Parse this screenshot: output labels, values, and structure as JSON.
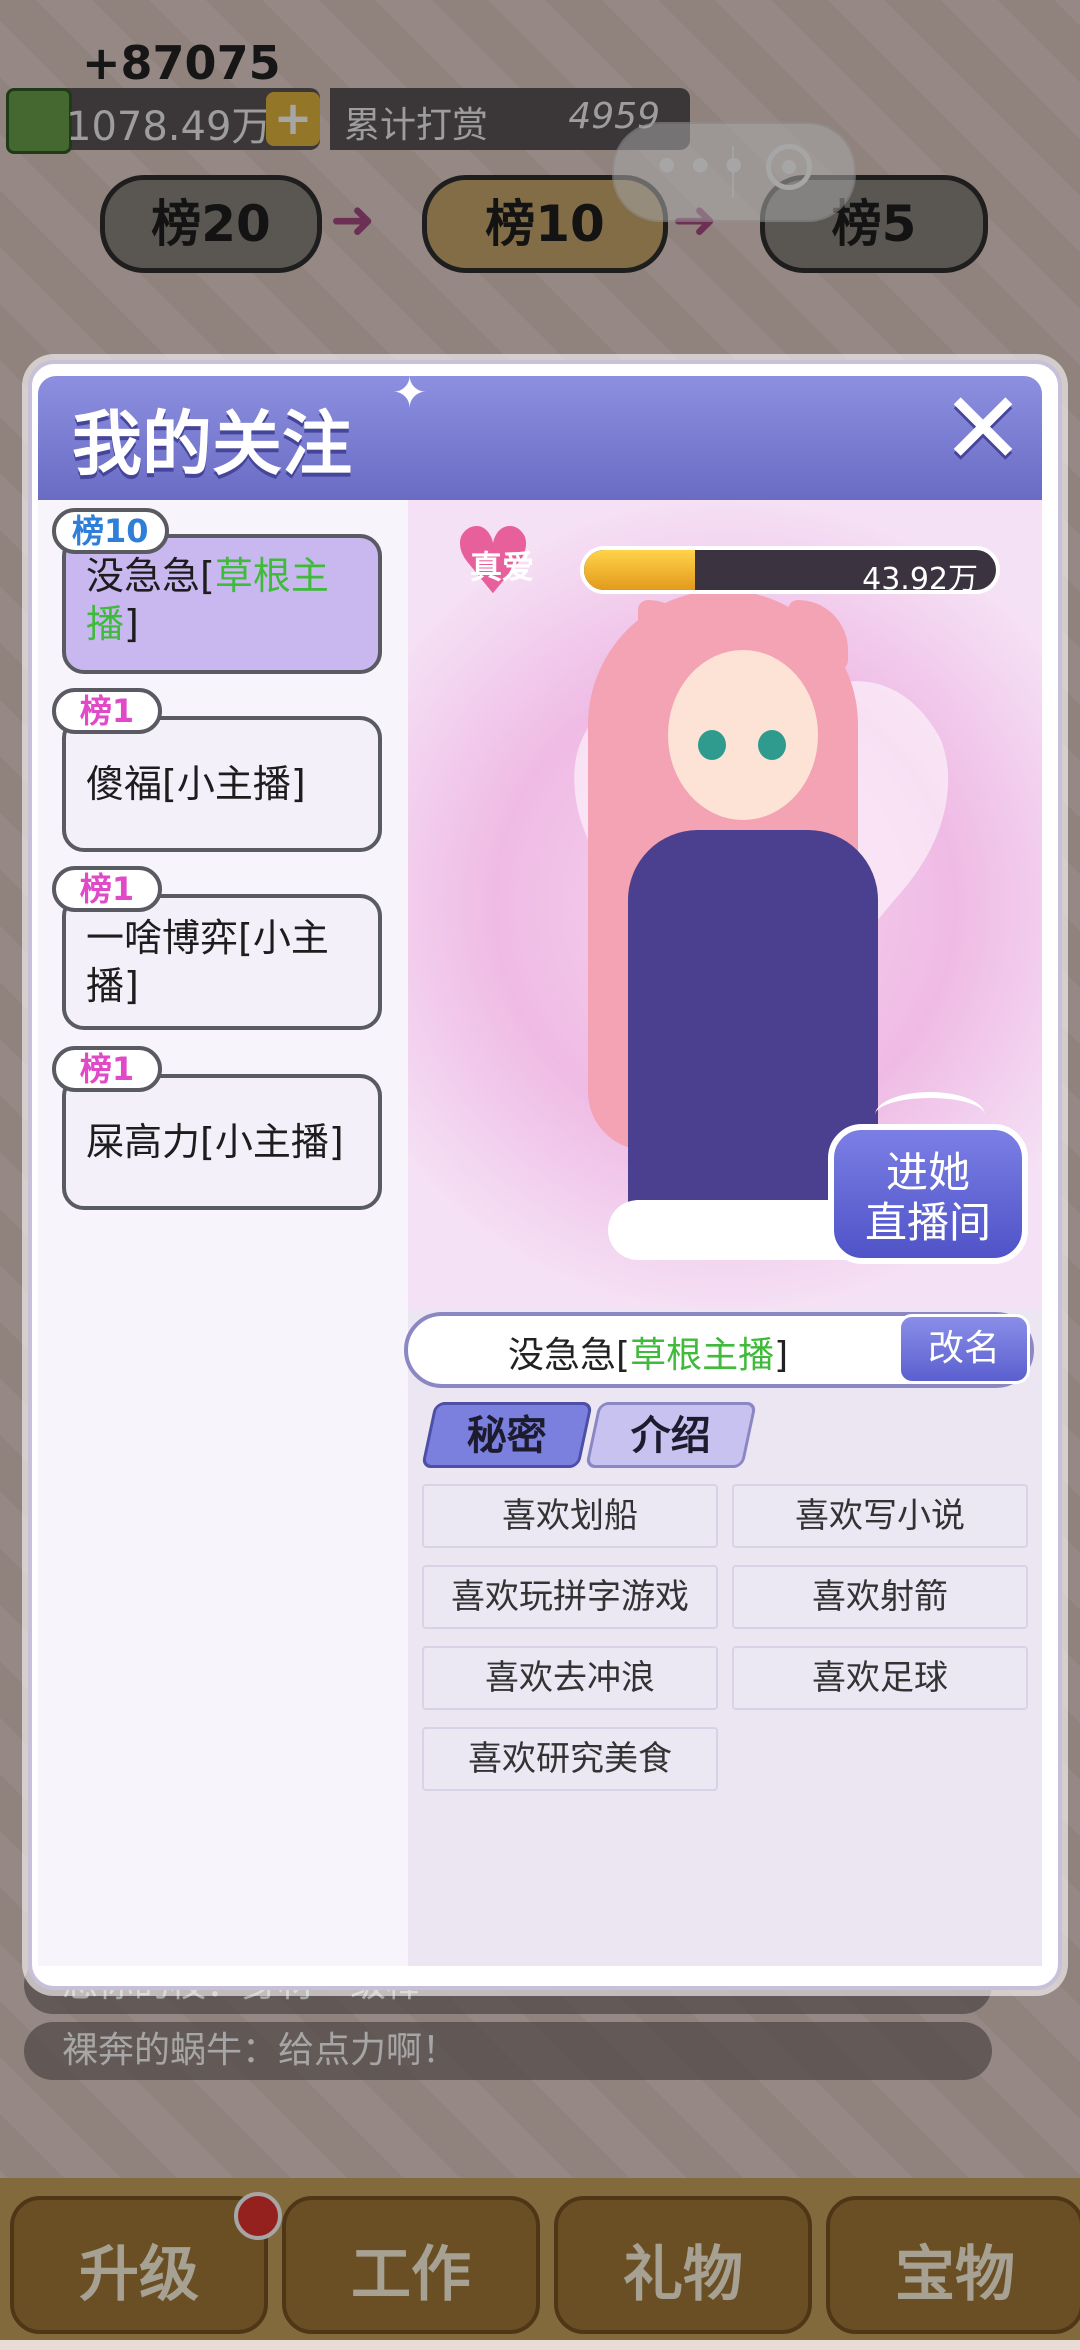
{
  "hud": {
    "amount_gain": "+87075",
    "money": "1078.49万",
    "plus": "+",
    "reward_label": "累计打赏",
    "reward_value": "4959"
  },
  "ranks": [
    {
      "label": "榜20"
    },
    {
      "label": "榜10"
    },
    {
      "label": "榜5"
    }
  ],
  "wechat_capsule": {
    "more_icon": "more-dots-icon",
    "close_icon": "target-circle-icon"
  },
  "modal": {
    "title": "我的关注",
    "close_label": "✕",
    "follows": [
      {
        "tag": "榜10",
        "tag_color": "#2f7fd8",
        "name": "没急急",
        "level": "草根主播",
        "selected": true
      },
      {
        "tag": "榜1",
        "tag_color": "#e04ac7",
        "name": "傻福",
        "level": "小主播",
        "selected": false
      },
      {
        "tag": "榜1",
        "tag_color": "#e04ac7",
        "name": "一啥博弈",
        "level": "小主播",
        "selected": false
      },
      {
        "tag": "榜1",
        "tag_color": "#e04ac7",
        "name": "屎高力",
        "level": "小主播",
        "selected": false
      }
    ],
    "love_label": "真爱",
    "love_value": "43.92万",
    "love_progress": 0.27,
    "live_button": "进她\n直播间",
    "selected_name": "没急急",
    "selected_level": "草根主播",
    "rename_button": "改名",
    "tabs": [
      {
        "label": "秘密",
        "active": true
      },
      {
        "label": "介绍",
        "active": false
      }
    ],
    "hobbies": [
      "喜欢划船",
      "喜欢写小说",
      "喜欢玩拼字游戏",
      "喜欢射箭",
      "喜欢去冲浪",
      "喜欢足球",
      "喜欢研究美食"
    ]
  },
  "chat": {
    "partial_line": "想你的枝：身材一级棒",
    "line": "裸奔的蜗牛：给点力啊！"
  },
  "nav": {
    "items": [
      "升级",
      "工作",
      "礼物",
      "宝物"
    ]
  },
  "colors": {
    "accent": "#6a6cc4",
    "green_level": "#3fba3a"
  }
}
